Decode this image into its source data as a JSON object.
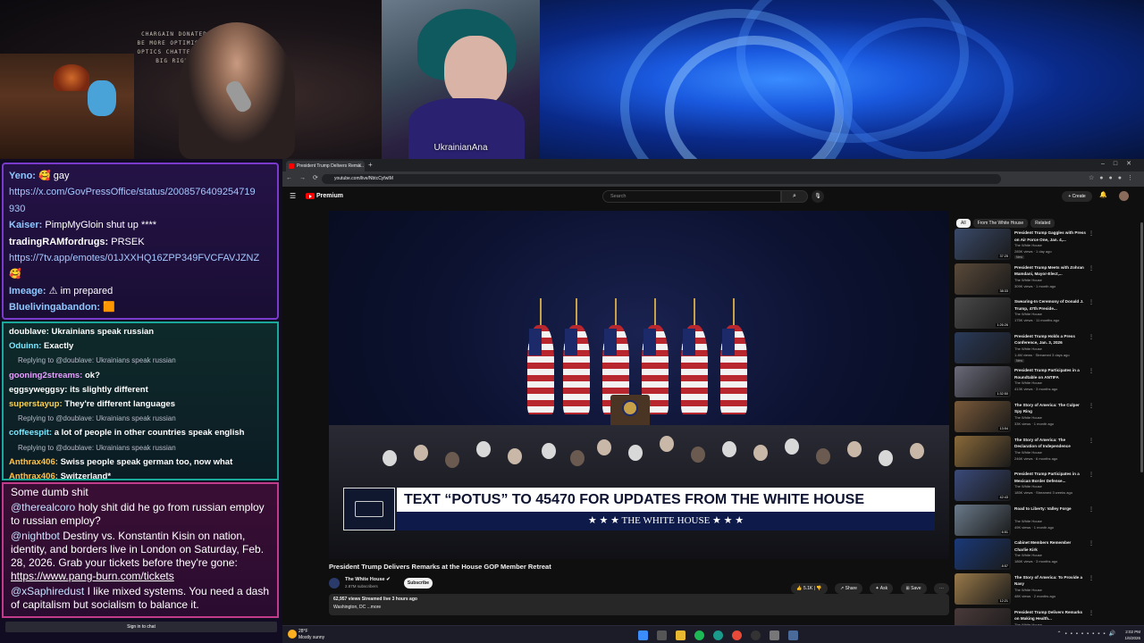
{
  "overlay": {
    "webcam_sign": "CHARGAIN DONATED\nBE MORE OPTIMISTIC\nOPTICS CHATTERS OF\nBIG RIGHT",
    "guest_label": "UkrainianAna"
  },
  "chat_top": [
    {
      "user": "Yeno:",
      "text": "gay"
    },
    {
      "user": "",
      "text": "https://x.com/GovPressOffice/status/2008576409254719",
      "link": true
    },
    {
      "user": "",
      "text": "930",
      "link": true
    },
    {
      "user": "Kaiser:",
      "text": "PimpMyGloin shut up ****"
    },
    {
      "user": "tradingRAMfordrugs:",
      "text": "PRSEK"
    },
    {
      "user": "",
      "text": "https://7tv.app/emotes/01JXXHQ16ZPP349FVCFAVJZNZ",
      "link": true
    },
    {
      "user": "",
      "text": ""
    },
    {
      "user": "Imeage:",
      "text": "im prepared"
    },
    {
      "user": "Bluelivingabandon:",
      "text": ""
    }
  ],
  "chat_mid": [
    {
      "type": "msg",
      "user": "doublave:",
      "cls": "u4",
      "text": "Ukrainians speak russian"
    },
    {
      "type": "msg",
      "user": "Oduinn:",
      "cls": "u3",
      "text": "Exactly"
    },
    {
      "type": "reply",
      "text": "Replying to @doublave: Ukrainians speak russian"
    },
    {
      "type": "msg",
      "user": "gooning2streams:",
      "cls": "u1",
      "text": "ok?"
    },
    {
      "type": "msg",
      "user": "eggsyweggsy:",
      "cls": "u4",
      "text": "its slightly different"
    },
    {
      "type": "msg",
      "user": "superstayup:",
      "cls": "u2",
      "text": "They're different languages"
    },
    {
      "type": "reply",
      "text": "Replying to @doublave: Ukrainians speak russian"
    },
    {
      "type": "msg",
      "user": "coffeespit:",
      "cls": "u3",
      "text": "a lot of people in other countries speak english"
    },
    {
      "type": "reply",
      "text": "Replying to @doublave: Ukrainians speak russian"
    },
    {
      "type": "msg",
      "user": "Anthrax406:",
      "cls": "u5",
      "text": "Swiss people speak german too, now what"
    },
    {
      "type": "msg",
      "user": "Anthrax406:",
      "cls": "u5",
      "text": "Switzerland*"
    }
  ],
  "chat_bot": {
    "m0": "Some dumb shit",
    "m1_user": "@therealcoro",
    "m1_text": "holy shit did he go from russian employ to russian employ?",
    "m2_user": "@nightbot",
    "m2_text": "Destiny vs. Konstantin Kisin on nation, identity, and borders live in London on Saturday, Feb. 28, 2026. Grab your tickets before they're gone:",
    "m2_link": "https://www.pang-burn.com/tickets",
    "m3_user": "@xSaphiredust",
    "m3_text": "I like mixed systems. You need a dash of capitalism but socialism to balance it.",
    "sign_in": "Sign in to chat"
  },
  "browser": {
    "tab_title": "President Trump Delivers Rema...",
    "url": "youtube.com/live/NbtcCyfwIM"
  },
  "youtube": {
    "logo": "Premium",
    "search_placeholder": "Search",
    "create": "+ Create",
    "video_title": "President Trump Delivers Remarks at the House GOP Member Retreat",
    "channel": "The White House",
    "subs": "2.87M subscribers",
    "subscribe": "Subscribe",
    "likes": "5.1K",
    "share": "Share",
    "ask": "Ask",
    "save": "Save",
    "desc_line1": "62,957 views  Streamed live 3 hours ago",
    "desc_line2": "Washington, DC ...more",
    "lower_third_top": "TEXT “POTUS” TO 45470 FOR UPDATES FROM THE WHITE HOUSE",
    "lower_third_bottom": "★ ★ ★  THE WHITE HOUSE  ★ ★ ★",
    "chips": [
      "All",
      "From The White House",
      "Related"
    ],
    "recommended": [
      {
        "title": "President Trump Gaggles with Press on Air Force One, Jan. 4,...",
        "channel": "The White House",
        "meta": "285K views · 1 day ago",
        "dur": "37:25",
        "badge": "New",
        "bg": "#3a4a6a"
      },
      {
        "title": "President Trump Meets with Zohran Mamdani, Mayor-Elect,...",
        "channel": "The White House",
        "meta": "309K views · 1 month ago",
        "dur": "38:33",
        "badge": "",
        "bg": "#5a4a3a"
      },
      {
        "title": "Swearing-In Ceremony of Donald J. Trump, 47th Preside...",
        "channel": "The White House",
        "meta": "175K views · 11 months ago",
        "dur": "1:26:26",
        "badge": "",
        "bg": "#4a4a4a"
      },
      {
        "title": "President Trump Holds a Press Conference, Jan. 3, 2026",
        "channel": "The White House",
        "meta": "1.4M views · Streamed 3 days ago",
        "dur": "",
        "badge": "New",
        "bg": "#2a3a5a"
      },
      {
        "title": "President Trump Participates in a Roundtable on ANTIFA",
        "channel": "The White House",
        "meta": "413K views · 3 months ago",
        "dur": "1:32:50",
        "badge": "",
        "bg": "#6a6a7a"
      },
      {
        "title": "The Story of America: The Culper Spy Ring",
        "channel": "The White House",
        "meta": "33K views · 1 month ago",
        "dur": "13:54",
        "badge": "",
        "bg": "#7a5a3a"
      },
      {
        "title": "The Story of America: The Declaration of Independence",
        "channel": "The White House",
        "meta": "246K views · 6 months ago",
        "dur": "",
        "badge": "",
        "bg": "#8a6a3a"
      },
      {
        "title": "President Trump Participates in a Mexican Border Defense...",
        "channel": "The White House",
        "meta": "185K views · Streamed 3 weeks ago",
        "dur": "42:43",
        "badge": "",
        "bg": "#3a4a7a"
      },
      {
        "title": "Road to Liberty: Valley Forge",
        "channel": "The White House",
        "meta": "49K views · 1 month ago",
        "dur": "6:51",
        "badge": "",
        "bg": "#6a7a8a"
      },
      {
        "title": "Cabinet Members Remember Charlie Kirk",
        "channel": "The White House",
        "meta": "186K views · 3 months ago",
        "dur": "8:57",
        "badge": "",
        "bg": "#1a3a7a"
      },
      {
        "title": "The Story of America: To Provide a Navy",
        "channel": "The White House",
        "meta": "48K views · 2 months ago",
        "dur": "12:21",
        "badge": "",
        "bg": "#9a7a4a"
      },
      {
        "title": "President Trump Delivers Remarks on Making Health...",
        "channel": "The White House",
        "meta": "",
        "dur": "",
        "badge": "",
        "bg": "#4a3a3a"
      }
    ]
  },
  "taskbar": {
    "temp": "28°F",
    "weather": "Mostly sunny",
    "time": "2:02 PM",
    "date": "1/6/2026"
  }
}
